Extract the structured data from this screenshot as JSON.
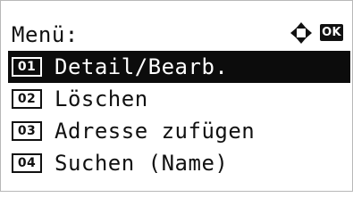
{
  "header": {
    "title": "Menü:",
    "nav_icon": "four-way-arrow-icon",
    "ok_label": "OK"
  },
  "menu": {
    "selected_index": 0,
    "items": [
      {
        "number": "01",
        "label": "Detail/Bearb."
      },
      {
        "number": "02",
        "label": "Löschen"
      },
      {
        "number": "03",
        "label": "Adresse zufügen"
      },
      {
        "number": "04",
        "label": "Suchen (Name)"
      }
    ]
  },
  "colors": {
    "background": "#ffffff",
    "foreground": "#111111",
    "selection": "#0c0c0c",
    "selected_text": "#ffffff"
  }
}
